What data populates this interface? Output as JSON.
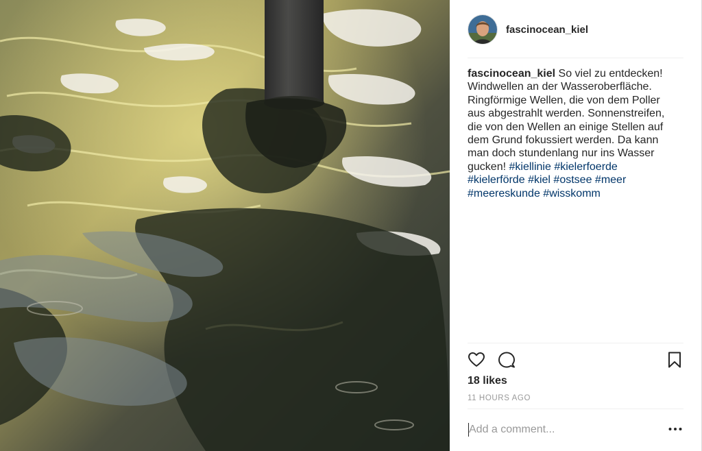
{
  "post": {
    "username": "fascinocean_kiel",
    "caption": {
      "username": "fascinocean_kiel",
      "text": "So viel zu entdecken! Windwellen an der Wasseroberfläche. Ringförmige Wellen, die von dem Poller aus abgestrahlt werden. Sonnenstreifen, die von den Wellen an einige Stellen auf dem Grund fokussiert werden. Da kann man doch stundenlang nur ins Wasser gucken!",
      "hashtags": [
        "#kiellinie",
        "#kielerfoerde",
        "#kielerförde",
        "#kiel",
        "#ostsee",
        "#meer",
        "#meereskunde",
        "#wisskomm"
      ]
    },
    "likes": "18 likes",
    "timestamp": "11 HOURS AGO"
  },
  "comment": {
    "placeholder": "Add a comment..."
  },
  "icons": {
    "like": "heart-icon",
    "comment": "comment-bubble-icon",
    "save": "bookmark-icon",
    "more": "more-options-icon"
  },
  "colors": {
    "hashtag": "#003569",
    "text": "#262626",
    "muted": "#999999"
  }
}
